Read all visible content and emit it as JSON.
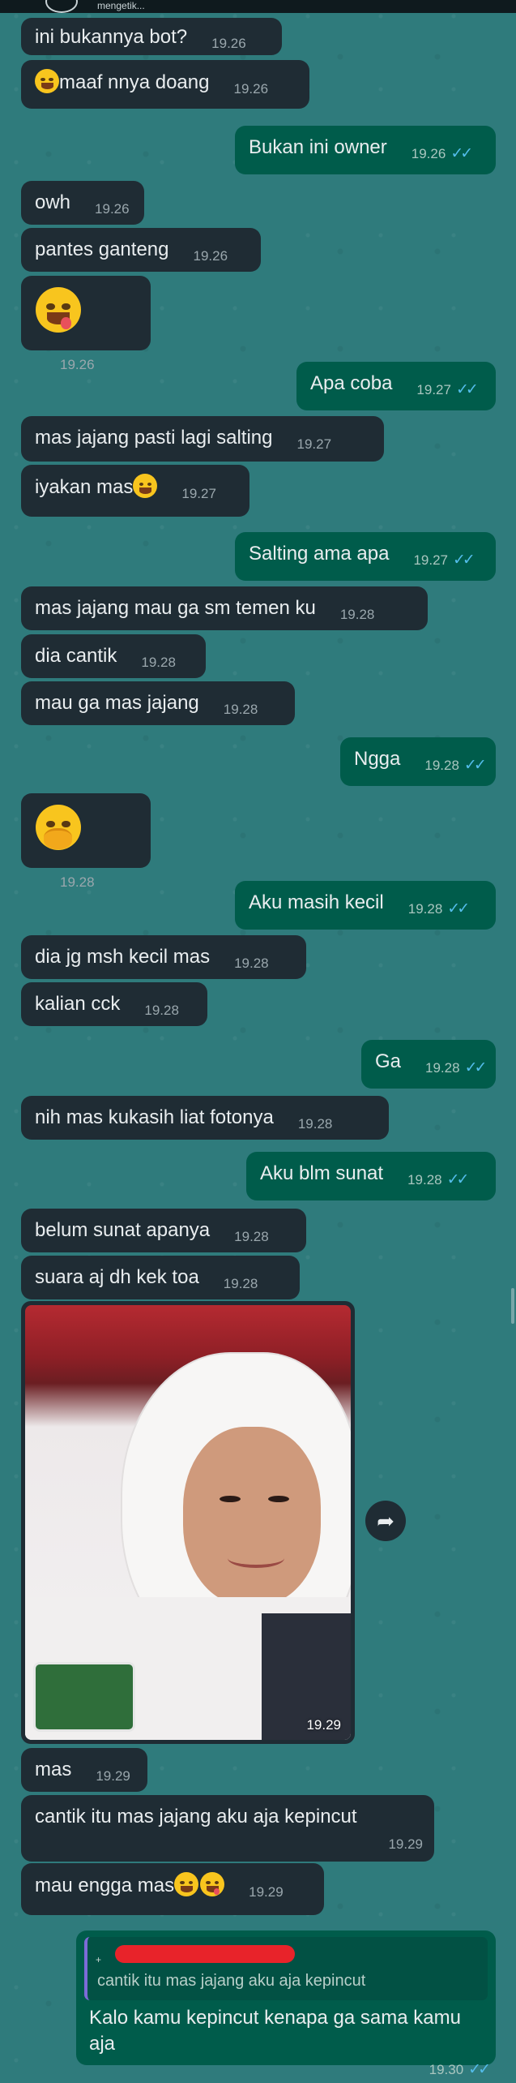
{
  "header": {
    "status_text": "mengetik..."
  },
  "messages": [
    {
      "id": "m1",
      "dir": "in",
      "text": "ini bukannya bot?",
      "time": "19.26"
    },
    {
      "id": "m2",
      "dir": "in",
      "text": "maaf nnya doang",
      "time": "19.26",
      "emoji": "grinning-face"
    },
    {
      "id": "m3",
      "dir": "out",
      "text": "Bukan ini owner",
      "time": "19.26",
      "status": "read"
    },
    {
      "id": "m4",
      "dir": "in",
      "text": "owh",
      "time": "19.26"
    },
    {
      "id": "m5",
      "dir": "in",
      "text": "pantes ganteng",
      "time": "19.26"
    },
    {
      "id": "m6",
      "dir": "in",
      "text": "",
      "time": "19.26",
      "emoji": "face-savoring-food"
    },
    {
      "id": "m7",
      "dir": "out",
      "text": "Apa coba",
      "time": "19.27",
      "status": "read"
    },
    {
      "id": "m8",
      "dir": "in",
      "text": "mas jajang pasti lagi salting",
      "time": "19.27"
    },
    {
      "id": "m9",
      "dir": "in",
      "text": "iyakan mas",
      "time": "19.27",
      "emoji": "smiling-face"
    },
    {
      "id": "m10",
      "dir": "out",
      "text": "Salting ama apa",
      "time": "19.27",
      "status": "read"
    },
    {
      "id": "m11",
      "dir": "in",
      "text": "mas jajang mau ga sm temen ku",
      "time": "19.28"
    },
    {
      "id": "m12",
      "dir": "in",
      "text": "dia cantik",
      "time": "19.28"
    },
    {
      "id": "m13",
      "dir": "in",
      "text": "mau ga mas jajang",
      "time": "19.28"
    },
    {
      "id": "m14",
      "dir": "out",
      "text": "Ngga",
      "time": "19.28",
      "status": "read"
    },
    {
      "id": "m15",
      "dir": "in",
      "text": "",
      "time": "19.28",
      "emoji": "face-with-hand-over-mouth"
    },
    {
      "id": "m16",
      "dir": "out",
      "text": "Aku masih kecil",
      "time": "19.28",
      "status": "read"
    },
    {
      "id": "m17",
      "dir": "in",
      "text": "dia jg msh kecil mas",
      "time": "19.28"
    },
    {
      "id": "m18",
      "dir": "in",
      "text": "kalian cck",
      "time": "19.28"
    },
    {
      "id": "m19",
      "dir": "out",
      "text": "Ga",
      "time": "19.28",
      "status": "read"
    },
    {
      "id": "m20",
      "dir": "in",
      "text": "nih mas kukasih liat fotonya",
      "time": "19.28"
    },
    {
      "id": "m21",
      "dir": "out",
      "text": "Aku blm sunat",
      "time": "19.28",
      "status": "read"
    },
    {
      "id": "m22",
      "dir": "in",
      "text": "belum sunat apanya",
      "time": "19.28"
    },
    {
      "id": "m23",
      "dir": "in",
      "text": "suara aj dh kek toa",
      "time": "19.28"
    },
    {
      "id": "m24",
      "dir": "in",
      "type": "photo",
      "time": "19.29"
    },
    {
      "id": "m25",
      "dir": "in",
      "text": "mas",
      "time": "19.29"
    },
    {
      "id": "m26",
      "dir": "in",
      "text": "cantik itu mas jajang aku aja kepincut",
      "time": "19.29"
    },
    {
      "id": "m27",
      "dir": "in",
      "text": "mau engga mas",
      "time": "19.29",
      "emoji": "smirking-face, face-with-tongue"
    },
    {
      "id": "m28",
      "dir": "out",
      "type": "reply",
      "quoted_text": "cantik itu mas jajang aku aja kepincut",
      "text": "Kalo kamu kepincut kenapa ga sama kamu aja",
      "time": "19.30",
      "status": "read"
    }
  ],
  "icons": {
    "read_ticks": "double-check-icon",
    "forward": "forward-icon"
  },
  "colors": {
    "background": "#2f7b7c",
    "incoming_bubble": "#1f2c34",
    "outgoing_bubble": "#005c4b",
    "read_ticks": "#53bdeb",
    "quote_bar": "#7d6bd8",
    "redaction": "#e8232a"
  }
}
